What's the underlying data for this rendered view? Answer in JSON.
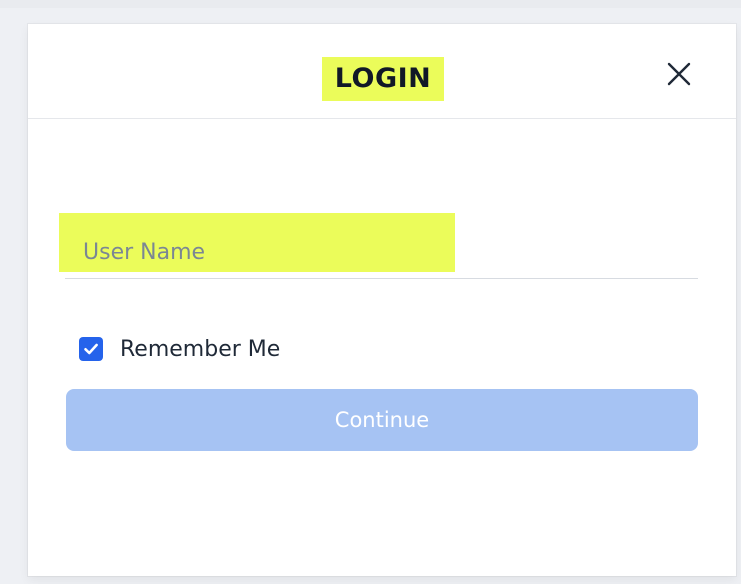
{
  "dialog": {
    "title": "LOGIN",
    "close_icon": "close-icon"
  },
  "form": {
    "username_placeholder": "User Name",
    "username_value": "",
    "remember_me_label": "Remember Me",
    "remember_me_checked": true,
    "continue_label": "Continue"
  },
  "colors": {
    "highlight": "#ebfc5a",
    "checkbox": "#2563eb",
    "continue_button": "#a6c3f3"
  }
}
